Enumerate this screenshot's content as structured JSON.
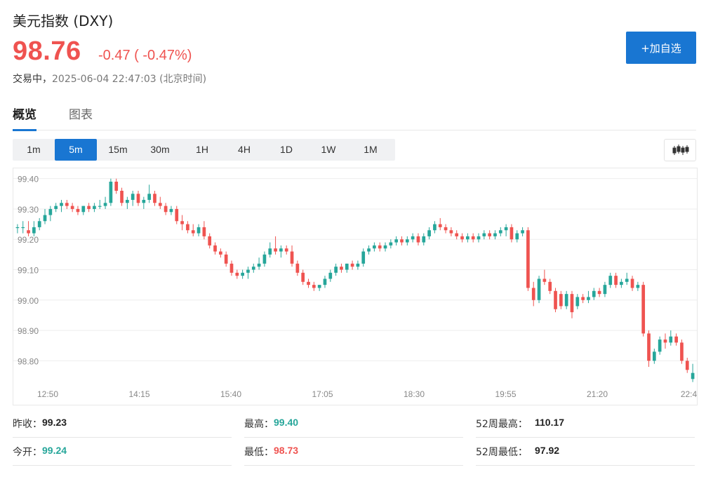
{
  "header": {
    "title": "美元指数 (DXY)",
    "price": "98.76",
    "change": "-0.47 ( -0.47%)",
    "status": "交易中，",
    "timestamp": "2025-06-04 22:47:03 (北京时间)",
    "watch_button": "+加自选"
  },
  "tabs": [
    "概览",
    "图表"
  ],
  "active_tab": 0,
  "periods": [
    "1m",
    "5m",
    "15m",
    "30m",
    "1H",
    "4H",
    "1D",
    "1W",
    "1M"
  ],
  "active_period": 1,
  "colors": {
    "up": "#26a69a",
    "down": "#ef5350",
    "accent": "#1976d2"
  },
  "chart_data": {
    "type": "candlestick",
    "x_ticks": [
      "12:50",
      "14:15",
      "15:40",
      "17:05",
      "18:30",
      "19:55",
      "21:20",
      "22:4"
    ],
    "y_ticks": [
      "99.40",
      "99.30",
      "99.20",
      "99.10",
      "99.00",
      "98.90",
      "98.80"
    ],
    "ylim": [
      98.75,
      99.42
    ],
    "grid": true,
    "ohlc": [
      [
        99.24,
        99.25,
        99.22,
        99.24
      ],
      [
        99.24,
        99.26,
        99.22,
        99.24
      ],
      [
        99.23,
        99.26,
        99.21,
        99.22
      ],
      [
        99.22,
        99.26,
        99.21,
        99.24
      ],
      [
        99.24,
        99.27,
        99.23,
        99.26
      ],
      [
        99.26,
        99.3,
        99.25,
        99.28
      ],
      [
        99.28,
        99.31,
        99.26,
        99.3
      ],
      [
        99.3,
        99.32,
        99.29,
        99.31
      ],
      [
        99.31,
        99.33,
        99.29,
        99.32
      ],
      [
        99.32,
        99.33,
        99.3,
        99.31
      ],
      [
        99.31,
        99.32,
        99.29,
        99.3
      ],
      [
        99.3,
        99.31,
        99.28,
        99.29
      ],
      [
        99.29,
        99.31,
        99.28,
        99.31
      ],
      [
        99.31,
        99.32,
        99.29,
        99.3
      ],
      [
        99.3,
        99.32,
        99.29,
        99.31
      ],
      [
        99.31,
        99.33,
        99.3,
        99.31
      ],
      [
        99.31,
        99.34,
        99.3,
        99.32
      ],
      [
        99.32,
        99.4,
        99.31,
        99.39
      ],
      [
        99.39,
        99.4,
        99.35,
        99.36
      ],
      [
        99.36,
        99.37,
        99.31,
        99.32
      ],
      [
        99.32,
        99.34,
        99.3,
        99.33
      ],
      [
        99.33,
        99.36,
        99.31,
        99.35
      ],
      [
        99.35,
        99.36,
        99.31,
        99.32
      ],
      [
        99.32,
        99.34,
        99.3,
        99.33
      ],
      [
        99.33,
        99.38,
        99.32,
        99.35
      ],
      [
        99.35,
        99.36,
        99.31,
        99.32
      ],
      [
        99.32,
        99.34,
        99.3,
        99.31
      ],
      [
        99.31,
        99.32,
        99.28,
        99.29
      ],
      [
        99.29,
        99.31,
        99.28,
        99.3
      ],
      [
        99.3,
        99.31,
        99.25,
        99.26
      ],
      [
        99.26,
        99.28,
        99.23,
        99.25
      ],
      [
        99.25,
        99.26,
        99.22,
        99.23
      ],
      [
        99.23,
        99.25,
        99.21,
        99.22
      ],
      [
        99.22,
        99.25,
        99.21,
        99.24
      ],
      [
        99.24,
        99.26,
        99.2,
        99.21
      ],
      [
        99.21,
        99.22,
        99.17,
        99.18
      ],
      [
        99.18,
        99.19,
        99.15,
        99.16
      ],
      [
        99.16,
        99.17,
        99.14,
        99.15
      ],
      [
        99.15,
        99.16,
        99.11,
        99.12
      ],
      [
        99.12,
        99.13,
        99.08,
        99.09
      ],
      [
        99.09,
        99.1,
        99.07,
        99.08
      ],
      [
        99.08,
        99.1,
        99.07,
        99.09
      ],
      [
        99.09,
        99.11,
        99.07,
        99.1
      ],
      [
        99.1,
        99.12,
        99.09,
        99.11
      ],
      [
        99.11,
        99.14,
        99.1,
        99.12
      ],
      [
        99.12,
        99.16,
        99.11,
        99.15
      ],
      [
        99.15,
        99.19,
        99.14,
        99.17
      ],
      [
        99.17,
        99.21,
        99.15,
        99.16
      ],
      [
        99.16,
        99.18,
        99.14,
        99.17
      ],
      [
        99.17,
        99.18,
        99.15,
        99.16
      ],
      [
        99.16,
        99.18,
        99.11,
        99.12
      ],
      [
        99.12,
        99.13,
        99.08,
        99.09
      ],
      [
        99.09,
        99.1,
        99.05,
        99.06
      ],
      [
        99.06,
        99.07,
        99.04,
        99.05
      ],
      [
        99.05,
        99.06,
        99.03,
        99.04
      ],
      [
        99.04,
        99.05,
        99.03,
        99.05
      ],
      [
        99.05,
        99.08,
        99.04,
        99.07
      ],
      [
        99.07,
        99.1,
        99.06,
        99.09
      ],
      [
        99.09,
        99.12,
        99.08,
        99.11
      ],
      [
        99.11,
        99.12,
        99.09,
        99.1
      ],
      [
        99.1,
        99.12,
        99.09,
        99.12
      ],
      [
        99.12,
        99.13,
        99.1,
        99.11
      ],
      [
        99.11,
        99.13,
        99.1,
        99.12
      ],
      [
        99.12,
        99.17,
        99.11,
        99.16
      ],
      [
        99.16,
        99.18,
        99.15,
        99.17
      ],
      [
        99.17,
        99.19,
        99.16,
        99.18
      ],
      [
        99.18,
        99.19,
        99.16,
        99.17
      ],
      [
        99.17,
        99.19,
        99.16,
        99.18
      ],
      [
        99.18,
        99.2,
        99.17,
        99.19
      ],
      [
        99.19,
        99.21,
        99.18,
        99.2
      ],
      [
        99.2,
        99.21,
        99.18,
        99.19
      ],
      [
        99.19,
        99.21,
        99.18,
        99.2
      ],
      [
        99.2,
        99.22,
        99.19,
        99.21
      ],
      [
        99.21,
        99.22,
        99.18,
        99.19
      ],
      [
        99.19,
        99.22,
        99.18,
        99.21
      ],
      [
        99.21,
        99.24,
        99.2,
        99.23
      ],
      [
        99.23,
        99.26,
        99.22,
        99.25
      ],
      [
        99.25,
        99.27,
        99.23,
        99.24
      ],
      [
        99.24,
        99.25,
        99.22,
        99.23
      ],
      [
        99.23,
        99.24,
        99.21,
        99.22
      ],
      [
        99.22,
        99.23,
        99.2,
        99.21
      ],
      [
        99.21,
        99.22,
        99.19,
        99.2
      ],
      [
        99.2,
        99.22,
        99.19,
        99.21
      ],
      [
        99.21,
        99.22,
        99.19,
        99.2
      ],
      [
        99.2,
        99.22,
        99.19,
        99.21
      ],
      [
        99.21,
        99.23,
        99.2,
        99.22
      ],
      [
        99.22,
        99.23,
        99.2,
        99.21
      ],
      [
        99.21,
        99.23,
        99.2,
        99.22
      ],
      [
        99.22,
        99.24,
        99.21,
        99.23
      ],
      [
        99.23,
        99.25,
        99.21,
        99.24
      ],
      [
        99.24,
        99.25,
        99.19,
        99.2
      ],
      [
        99.2,
        99.23,
        99.19,
        99.22
      ],
      [
        99.22,
        99.24,
        99.21,
        99.23
      ],
      [
        99.23,
        99.24,
        99.03,
        99.04
      ],
      [
        99.04,
        99.06,
        98.98,
        99.0
      ],
      [
        99.0,
        99.08,
        98.99,
        99.07
      ],
      [
        99.07,
        99.1,
        99.05,
        99.06
      ],
      [
        99.06,
        99.07,
        99.02,
        99.03
      ],
      [
        99.03,
        99.04,
        98.96,
        98.97
      ],
      [
        99.02,
        99.03,
        98.97,
        98.98
      ],
      [
        98.98,
        99.03,
        98.97,
        99.02
      ],
      [
        99.02,
        99.03,
        98.94,
        98.96
      ],
      [
        98.98,
        99.02,
        98.97,
        99.01
      ],
      [
        99.01,
        99.02,
        98.99,
        99.0
      ],
      [
        99.0,
        99.03,
        98.99,
        99.01
      ],
      [
        99.01,
        99.04,
        99.0,
        99.03
      ],
      [
        99.03,
        99.04,
        99.01,
        99.02
      ],
      [
        99.02,
        99.06,
        99.01,
        99.05
      ],
      [
        99.05,
        99.09,
        99.04,
        99.08
      ],
      [
        99.08,
        99.09,
        99.04,
        99.05
      ],
      [
        99.05,
        99.07,
        99.04,
        99.06
      ],
      [
        99.06,
        99.09,
        99.05,
        99.07
      ],
      [
        99.07,
        99.08,
        99.03,
        99.04
      ],
      [
        99.04,
        99.06,
        99.03,
        99.05
      ],
      [
        99.05,
        99.06,
        98.88,
        98.89
      ],
      [
        98.89,
        98.9,
        98.78,
        98.8
      ],
      [
        98.8,
        98.84,
        98.79,
        98.83
      ],
      [
        98.83,
        98.88,
        98.82,
        98.87
      ],
      [
        98.87,
        98.89,
        98.84,
        98.86
      ],
      [
        98.86,
        98.9,
        98.85,
        98.88
      ],
      [
        98.88,
        98.89,
        98.85,
        98.86
      ],
      [
        98.86,
        98.87,
        98.79,
        98.8
      ],
      [
        98.8,
        98.81,
        98.76,
        98.77
      ],
      [
        98.74,
        98.79,
        98.73,
        98.76
      ]
    ]
  },
  "stats": [
    [
      {
        "label": "昨收：",
        "value": "99.23",
        "color": "dark"
      },
      {
        "label": "最高：",
        "value": "99.40",
        "color": "green"
      },
      {
        "label": "52周最高：",
        "value": "110.17",
        "color": "dark"
      }
    ],
    [
      {
        "label": "今开：",
        "value": "99.24",
        "color": "green"
      },
      {
        "label": "最低：",
        "value": "98.73",
        "color": "down"
      },
      {
        "label": "52周最低：",
        "value": "97.92",
        "color": "dark"
      }
    ]
  ]
}
